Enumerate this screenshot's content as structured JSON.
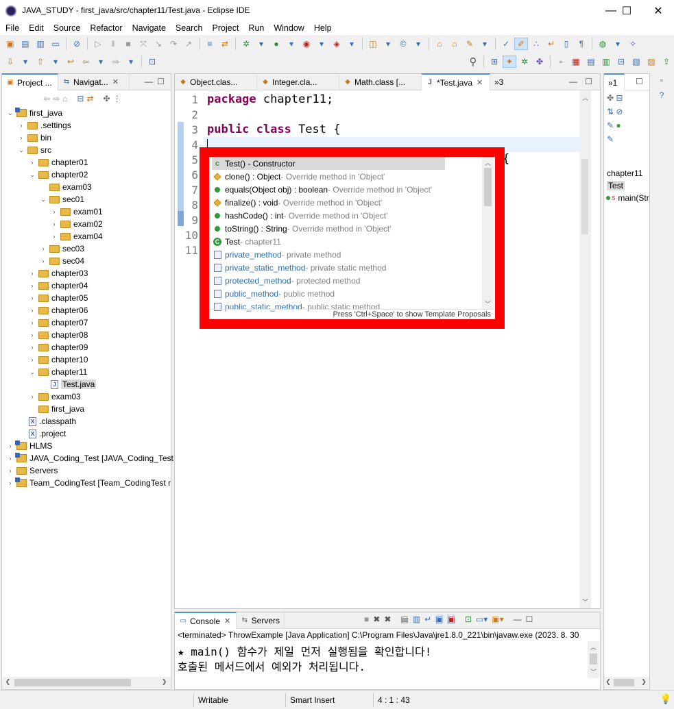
{
  "window": {
    "title": "JAVA_STUDY - first_java/src/chapter11/Test.java - Eclipse IDE",
    "minimize": "—",
    "maximize": "☐",
    "close": "✕"
  },
  "menu": [
    "File",
    "Edit",
    "Source",
    "Refactor",
    "Navigate",
    "Search",
    "Project",
    "Run",
    "Window",
    "Help"
  ],
  "left_panel": {
    "tabs": [
      {
        "label": "Project ..."
      },
      {
        "label": "Navigat..."
      }
    ],
    "tree": [
      {
        "label": "first_java",
        "depth": 0,
        "twisty": "v",
        "icon": "project"
      },
      {
        "label": ".settings",
        "depth": 1,
        "twisty": ">",
        "icon": "folder"
      },
      {
        "label": "bin",
        "depth": 1,
        "twisty": ">",
        "icon": "folder"
      },
      {
        "label": "src",
        "depth": 1,
        "twisty": "v",
        "icon": "folder"
      },
      {
        "label": "chapter01",
        "depth": 2,
        "twisty": ">",
        "icon": "folder"
      },
      {
        "label": "chapter02",
        "depth": 2,
        "twisty": "v",
        "icon": "folder"
      },
      {
        "label": "exam03",
        "depth": 3,
        "twisty": "",
        "icon": "folder"
      },
      {
        "label": "sec01",
        "depth": 3,
        "twisty": "v",
        "icon": "folder"
      },
      {
        "label": "exam01",
        "depth": 4,
        "twisty": ">",
        "icon": "folder"
      },
      {
        "label": "exam02",
        "depth": 4,
        "twisty": ">",
        "icon": "folder"
      },
      {
        "label": "exam04",
        "depth": 4,
        "twisty": ">",
        "icon": "folder"
      },
      {
        "label": "sec03",
        "depth": 3,
        "twisty": ">",
        "icon": "folder"
      },
      {
        "label": "sec04",
        "depth": 3,
        "twisty": ">",
        "icon": "folder"
      },
      {
        "label": "chapter03",
        "depth": 2,
        "twisty": ">",
        "icon": "folder"
      },
      {
        "label": "chapter04",
        "depth": 2,
        "twisty": ">",
        "icon": "folder"
      },
      {
        "label": "chapter05",
        "depth": 2,
        "twisty": ">",
        "icon": "folder"
      },
      {
        "label": "chapter06",
        "depth": 2,
        "twisty": ">",
        "icon": "folder"
      },
      {
        "label": "chapter07",
        "depth": 2,
        "twisty": ">",
        "icon": "folder"
      },
      {
        "label": "chapter08",
        "depth": 2,
        "twisty": ">",
        "icon": "folder"
      },
      {
        "label": "chapter09",
        "depth": 2,
        "twisty": ">",
        "icon": "folder"
      },
      {
        "label": "chapter10",
        "depth": 2,
        "twisty": ">",
        "icon": "folder"
      },
      {
        "label": "chapter11",
        "depth": 2,
        "twisty": "v",
        "icon": "folder"
      },
      {
        "label": "Test.java",
        "depth": 3,
        "twisty": "",
        "icon": "java",
        "selected": true
      },
      {
        "label": "exam03",
        "depth": 2,
        "twisty": ">",
        "icon": "folder"
      },
      {
        "label": "first_java",
        "depth": 2,
        "twisty": "",
        "icon": "folder"
      },
      {
        "label": ".classpath",
        "depth": 1,
        "twisty": "",
        "icon": "xfile"
      },
      {
        "label": ".project",
        "depth": 1,
        "twisty": "",
        "icon": "xfile"
      },
      {
        "label": "HLMS",
        "depth": 0,
        "twisty": ">",
        "icon": "project"
      },
      {
        "label": "JAVA_Coding_Test [JAVA_Coding_Test",
        "depth": 0,
        "twisty": ">",
        "icon": "project"
      },
      {
        "label": "Servers",
        "depth": 0,
        "twisty": ">",
        "icon": "folder"
      },
      {
        "label": "Team_CodingTest [Team_CodingTest r",
        "depth": 0,
        "twisty": ">",
        "icon": "project"
      }
    ]
  },
  "editor": {
    "tabs": [
      {
        "label": "Object.clas..."
      },
      {
        "label": "Integer.cla..."
      },
      {
        "label": "Math.class [..."
      },
      {
        "label": "*Test.java",
        "active": true
      }
    ],
    "overflow_label": "»3",
    "lines": [
      {
        "n": "1",
        "kw": "package",
        "rest": " chapter11;"
      },
      {
        "n": "2",
        "kw": "",
        "rest": ""
      },
      {
        "n": "3",
        "kw": "public class",
        "rest": " Test {"
      },
      {
        "n": "4",
        "kw": "",
        "rest": ""
      },
      {
        "n": "5",
        "kw": "",
        "rest": ""
      },
      {
        "n": "6",
        "kw": "",
        "rest": ""
      },
      {
        "n": "7",
        "kw": "",
        "rest": ""
      },
      {
        "n": "8",
        "kw": "",
        "rest": ""
      },
      {
        "n": "9",
        "kw": "",
        "rest": ""
      },
      {
        "n": "10",
        "kw": "",
        "rest": "}"
      },
      {
        "n": "11",
        "kw": "",
        "rest": ""
      }
    ],
    "peek_brace": "{"
  },
  "content_assist": {
    "proposals": [
      {
        "icon": "ctor",
        "sig": "Test() - Constructor",
        "desc": "",
        "selected": true
      },
      {
        "icon": "protected",
        "sig": "clone() : Object",
        "desc": " - Override method in 'Object'"
      },
      {
        "icon": "public",
        "sig": "equals(Object obj) : boolean",
        "desc": " - Override method in 'Object'"
      },
      {
        "icon": "protected",
        "sig": "finalize() : void",
        "desc": " - Override method in 'Object'"
      },
      {
        "icon": "public",
        "sig": "hashCode() : int",
        "desc": " - Override method in 'Object'"
      },
      {
        "icon": "public",
        "sig": "toString() : String",
        "desc": " - Override method in 'Object'"
      },
      {
        "icon": "class",
        "sig": "Test",
        "desc": " - chapter11"
      },
      {
        "icon": "template",
        "sig": "private_method",
        "desc": " - private method"
      },
      {
        "icon": "template",
        "sig": "private_static_method",
        "desc": " - private static method"
      },
      {
        "icon": "template",
        "sig": "protected_method",
        "desc": " - protected method"
      },
      {
        "icon": "template",
        "sig": "public_method",
        "desc": " - public method"
      },
      {
        "icon": "template",
        "sig": "public_static_method",
        "desc": " - public static method"
      }
    ],
    "footer": "Press 'Ctrl+Space' to show Template Proposals"
  },
  "outline": {
    "overflow_label": "»1",
    "items": [
      "chapter11",
      "Test",
      "main(Str"
    ],
    "main_marker": "S"
  },
  "console": {
    "tabs": [
      {
        "label": "Console"
      },
      {
        "label": "Servers"
      }
    ],
    "header": "<terminated> ThrowExample [Java Application] C:\\Program Files\\Java\\jre1.8.0_221\\bin\\javaw.exe  (2023. 8. 30",
    "lines": [
      "★ main() 함수가 제일 먼저 실행됨을 확인합니다!",
      "호출된 메서드에서 예외가 처리됩니다."
    ]
  },
  "status": {
    "writable": "Writable",
    "insert_mode": "Smart Insert",
    "position": "4 : 1 : 43"
  },
  "colors": {
    "highlight_border": "#ff0000",
    "keyword": "#7f0055"
  }
}
